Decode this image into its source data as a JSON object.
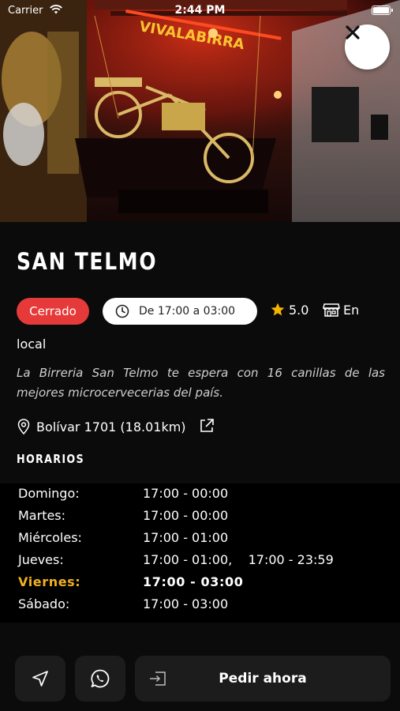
{
  "status_bar": {
    "carrier": "Carrier",
    "time": "2:44 PM"
  },
  "hero": {
    "neon_sign": "VIVALABIRRA"
  },
  "venue": {
    "name": "SAN TELMO",
    "status_badge": "Cerrado",
    "hours_chip": "De 17:00 a 03:00",
    "rating": "5.0",
    "service_type_line1": "En",
    "service_type_line2": "local",
    "description": "La Birreria San Telmo te espera con 16 canillas de las mejores microcervecerias del país.",
    "address": "Bolívar 1701 (18.01km)"
  },
  "schedule": {
    "title": "HORARIOS",
    "rows": [
      {
        "day": "Domingo:",
        "times": "17:00 - 00:00"
      },
      {
        "day": "Martes:",
        "times": "17:00 - 00:00"
      },
      {
        "day": "Miércoles:",
        "times": "17:00 - 01:00"
      },
      {
        "day": "Jueves:",
        "times": "17:00 - 01:00,    17:00 - 23:59"
      },
      {
        "day": "Viernes:",
        "times": "17:00 - 03:00",
        "today": true
      },
      {
        "day": "Sábado:",
        "times": "17:00 - 03:00"
      }
    ]
  },
  "actions": {
    "order_label": "Pedir ahora",
    "icons": [
      "navigation-arrow-icon",
      "whatsapp-icon",
      "login-icon"
    ]
  },
  "colors": {
    "background": "#0b0b0b",
    "closed_badge": "#e63a3a",
    "today_highlight": "#f2b01e",
    "star": "#f5b400",
    "button_bg": "#1c1c1c"
  }
}
